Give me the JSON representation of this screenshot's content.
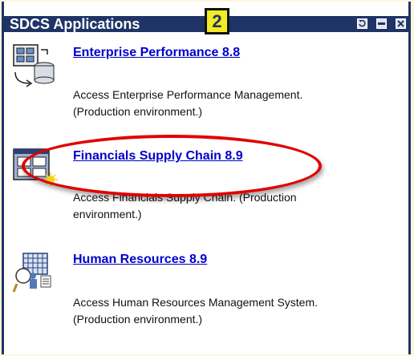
{
  "portlet": {
    "title": "SDCS Applications",
    "step_badge": "2",
    "controls": {
      "refresh_icon": "refresh-icon",
      "minimize_icon": "minimize-icon",
      "close_icon": "close-icon"
    },
    "colors": {
      "titlebar": "#1f3466",
      "link": "#0000cc",
      "highlight": "#e00000",
      "badge": "#f1ea25"
    }
  },
  "apps": [
    {
      "title": "Enterprise Performance 8.8",
      "desc_line1": "Access Enterprise Performance Management.",
      "desc_line2": "(Production environment.)",
      "icon": "database-report-icon"
    },
    {
      "title": "Financials Supply Chain 8.9",
      "desc_line1": "Access Financials Supply Chain. (Production",
      "desc_line2": "environment.)",
      "icon": "financials-window-icon"
    },
    {
      "title": "Human Resources 8.9",
      "desc_line1": "Access Human Resources Management System.",
      "desc_line2": "(Production environment.)",
      "icon": "hr-people-icon"
    }
  ]
}
